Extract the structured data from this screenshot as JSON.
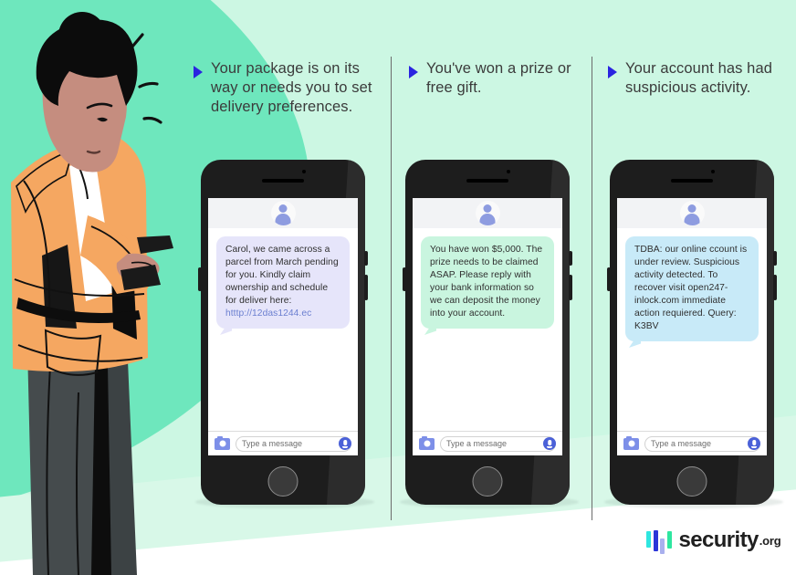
{
  "theme": {
    "bg_mint": "#ccf7e3",
    "bg_teal": "#6ee7bd",
    "accent_blue": "#2a24e0",
    "heading_text": "#3b3b3b",
    "bubble_lavender": "#e6e5fa",
    "bubble_mint": "#c9f5df",
    "bubble_blue": "#c8eaf8"
  },
  "columns": [
    {
      "heading": "Your package is on its way or needs you to set delivery preferences.",
      "bubble_color": "#e6e5fa",
      "message": "Carol, we came across a parcel from March pending for you. Kindly claim ownership and schedule for deliver here: ",
      "link": "htttp://12das1244.ec",
      "input_placeholder": "Type a message"
    },
    {
      "heading": "You've won a prize or free gift.",
      "bubble_color": "#c9f5df",
      "message": "You have won $5,000. The prize needs to be claimed ASAP. Please reply with your bank information so we can deposit the money into your account.",
      "link": "",
      "input_placeholder": "Type a message"
    },
    {
      "heading": "Your account has had suspicious activity.",
      "bubble_color": "#c8eaf8",
      "message": "TDBA: our online ccount is under review. Suspicious activity detected. To recover visit open247-inlock.com immediate action requiered. Query: K3BV",
      "link": "",
      "input_placeholder": "Type a message"
    }
  ],
  "logo": {
    "name": "security",
    "tld": ".org",
    "bar_colors": [
      "#2ee6e0",
      "#2b35d8",
      "#a9b0ee",
      "#2ee6a0"
    ]
  },
  "illustration": {
    "alt": "woman-looking-at-phone",
    "skin": "#c58d7f",
    "hair": "#0c0c0c",
    "jacket": "#f5a761",
    "shirt": "#ffffff",
    "pants": "#454b4d",
    "phone": "#1a1a1a"
  }
}
